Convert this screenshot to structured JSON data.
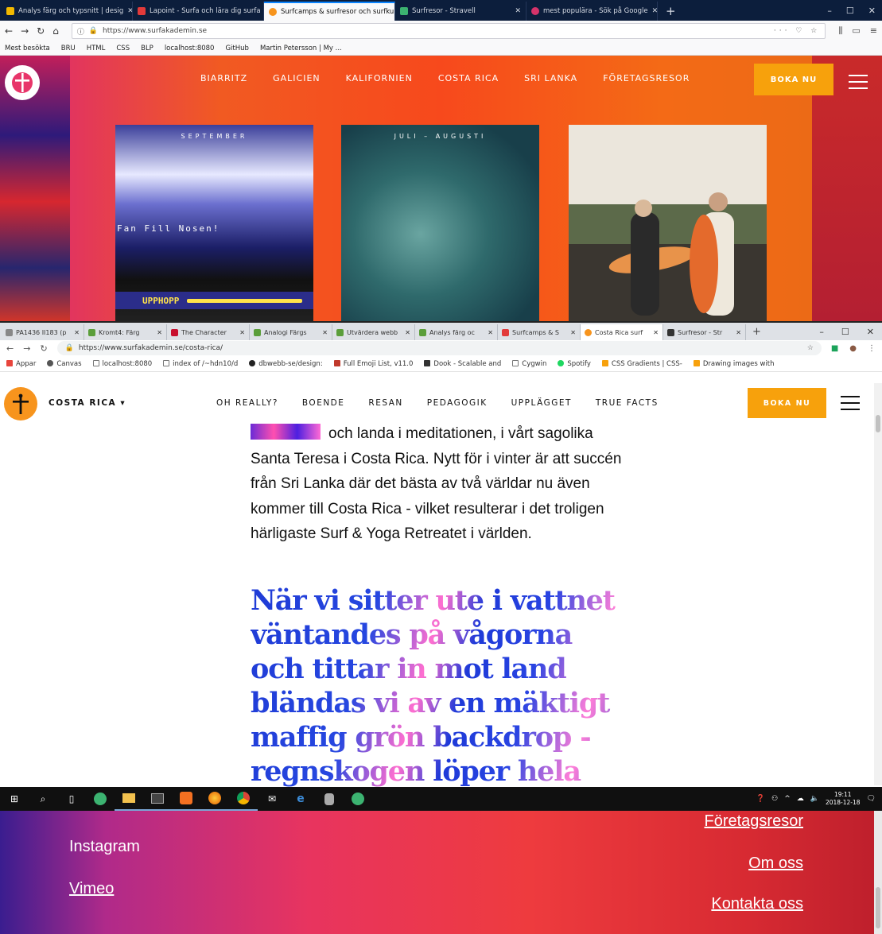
{
  "firefox": {
    "tabs": [
      {
        "title": "Analys färg och typsnitt | desig"
      },
      {
        "title": "Lapoint - Surfa och lära dig surfa"
      },
      {
        "title": "Surfcamps & surfresor och surfkurs"
      },
      {
        "title": "Surfresor - Stravell"
      },
      {
        "title": "mest populära - Sök på Google"
      }
    ],
    "url": "https://www.surfakademin.se",
    "bookmarks": [
      "Mest besökta",
      "BRU",
      "HTML",
      "CSS",
      "BLP",
      "localhost:8080",
      "GitHub",
      "Martin Petersson | My ..."
    ],
    "site": {
      "nav": [
        "BIARRITZ",
        "GALICIEN",
        "KALIFORNIEN",
        "COSTA RICA",
        "SRI LANKA",
        "FÖRETAGSRESOR"
      ],
      "book_label": "BOKA NU",
      "cards": [
        {
          "title": "SEPTEMBER",
          "game_text": "Fan Fill Nosen!",
          "bar_label": "UPPHOPP"
        },
        {
          "title": "JULI – AUGUSTI"
        },
        {
          "title": ""
        }
      ]
    }
  },
  "chrome": {
    "tabs": [
      {
        "title": "PA1436 II183 (p"
      },
      {
        "title": "Kromt4: Färg"
      },
      {
        "title": "The Character"
      },
      {
        "title": "Analogi Färgs"
      },
      {
        "title": "Utvärdera webb"
      },
      {
        "title": "Analys färg oc"
      },
      {
        "title": "Surfcamps & S"
      },
      {
        "title": "Costa Rica surf"
      },
      {
        "title": "Surfresor - Str"
      }
    ],
    "url": "https://www.surfakademin.se/costa-rica/",
    "bookmarks": [
      "Appar",
      "Canvas",
      "localhost:8080",
      "index of /~hdn10/d",
      "dbwebb-se/design:",
      "Full Emoji List, v11.0",
      "Dook - Scalable and",
      "Cygwin",
      "Spotify",
      "CSS Gradients | CSS-",
      "Drawing images with"
    ],
    "site": {
      "region": "COSTA RICA",
      "nav": [
        "OH REALLY?",
        "BOENDE",
        "RESAN",
        "PEDAGOGIK",
        "UPPLÄGGET",
        "TRUE FACTS"
      ],
      "book_label": "BOKA NU",
      "paragraph": {
        "line1": "och landa i meditationen, i vårt",
        "rest": "sagolika Santa Teresa i Costa Rica. Nytt för i vinter är att succén från Sri Lanka där det bästa av två världar nu även kommer till Costa Rica - vilket resulterar i det troligen härligaste Surf & Yoga Retreatet i världen."
      },
      "quote": "När vi sitter ute i vattnet väntandes på vågorna och tittar in mot land bländas vi av en mäktigt maffig grön backdrop - regnskogen löper hela"
    }
  },
  "taskbar": {
    "time": "19:11",
    "date": "2018-12-18"
  },
  "footer": {
    "left_links": [
      "Instagram",
      "Vimeo"
    ],
    "right_links": [
      "Företagsresor",
      "Om oss",
      "Kontakta oss"
    ]
  },
  "colors": {
    "accent_orange": "#f7a10c",
    "quote_blue": "#1f3bd6",
    "quote_pink": "#ff6fd0"
  }
}
